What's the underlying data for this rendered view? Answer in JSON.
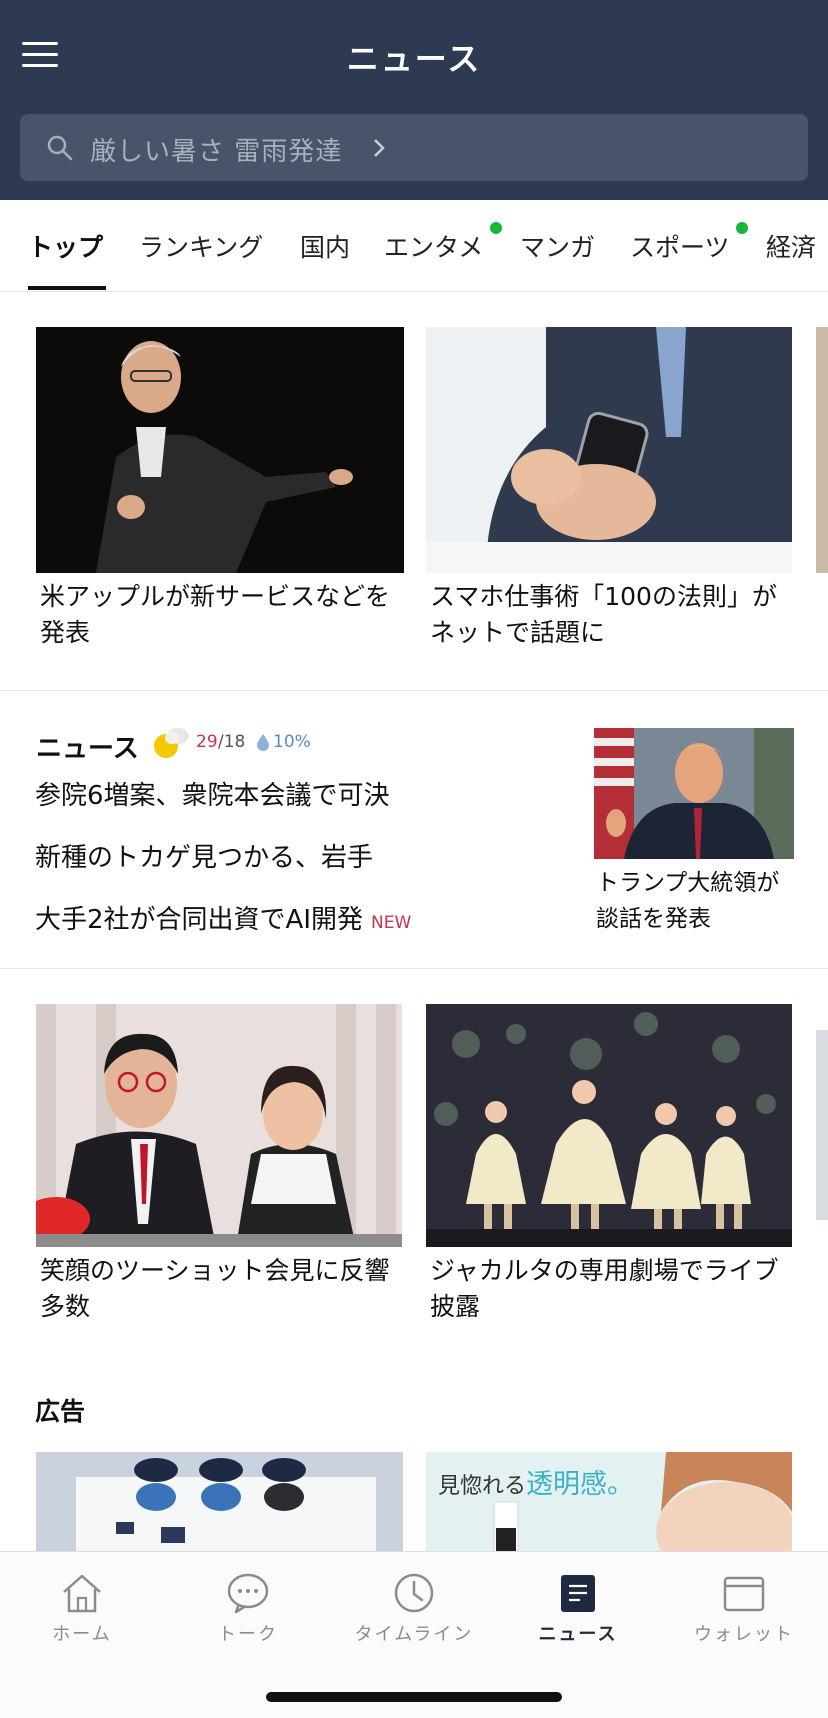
{
  "header": {
    "title": "ニュース",
    "search_text": "厳しい暑さ 雷雨発達"
  },
  "tabs": [
    {
      "label": "トップ"
    },
    {
      "label": "ランキング"
    },
    {
      "label": "国内"
    },
    {
      "label": "エンタメ"
    },
    {
      "label": "マンガ"
    },
    {
      "label": "スポーツ"
    },
    {
      "label": "経済"
    }
  ],
  "top_cards": [
    {
      "caption": "米アップルが新サービスなどを発表"
    },
    {
      "caption": "スマホ仕事術「100の法則」がネットで話題に"
    }
  ],
  "news_block": {
    "heading": "ニュース",
    "weather_icon": "sun-cloud-icon",
    "temp_high": "29",
    "temp_low": "/18",
    "rain": "10%",
    "headlines": [
      {
        "text": "参院6増案、衆院本会議で可決"
      },
      {
        "text": "新種のトカゲ見つかる、岩手"
      },
      {
        "text": "大手2社が合同出資でAI開発",
        "badge": "NEW"
      }
    ],
    "side_caption": "トランプ大統領が談話を発表"
  },
  "mid_cards": [
    {
      "caption": "笑顔のツーショット会見に反響多数"
    },
    {
      "caption": "ジャカルタの専用劇場でライブ披露"
    }
  ],
  "ads": {
    "label": "広告",
    "ad2_text": "見惚れる",
    "ad2_accent": "透明感。"
  },
  "bottom_nav": [
    {
      "label": "ホーム",
      "icon": "home-icon"
    },
    {
      "label": "トーク",
      "icon": "chat-icon"
    },
    {
      "label": "タイムライン",
      "icon": "clock-icon"
    },
    {
      "label": "ニュース",
      "icon": "news-icon",
      "active": true
    },
    {
      "label": "ウォレット",
      "icon": "wallet-icon"
    }
  ],
  "colors": {
    "header_bg": "#2e3a52",
    "search_bg": "#485469",
    "tab_dot": "#18b63a",
    "accent_red": "#c8334b",
    "nav_active": "#1e2a40"
  }
}
